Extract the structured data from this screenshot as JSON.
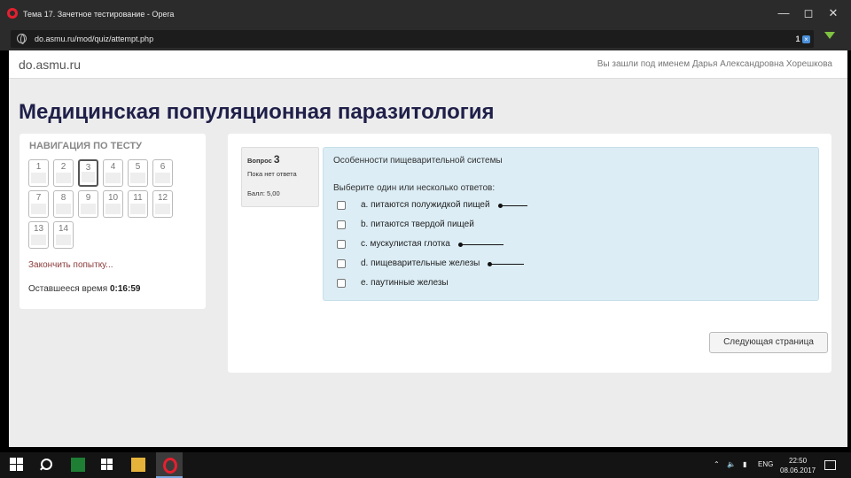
{
  "browser": {
    "window_title": "Тема 17. Зачетное тестирование - Opera",
    "url": "do.asmu.ru/mod/quiz/attempt.php",
    "address_badge": "1"
  },
  "header": {
    "site_name": "do.asmu.ru",
    "login_info": "Вы зашли под именем Дарья Александровна Хорешкова"
  },
  "course_title": "Медицинская популяционная паразитология",
  "navigation": {
    "title": "НАВИГАЦИЯ ПО ТЕСТУ",
    "questions": [
      "1",
      "2",
      "3",
      "4",
      "5",
      "6",
      "7",
      "8",
      "9",
      "10",
      "11",
      "12",
      "13",
      "14"
    ],
    "current": "3",
    "finish_label": "Закончить попытку...",
    "time_label": "Оставшееся время",
    "time_value": "0:16:59"
  },
  "question": {
    "label": "Вопрос",
    "number": "3",
    "state": "Пока нет ответа",
    "grade": "Балл: 5,00",
    "topic": "Особенности пищеварительной системы",
    "prompt": "Выберите один или несколько ответов:",
    "options": [
      {
        "text": "a. питаются полужидкой пищей",
        "marked": true
      },
      {
        "text": "b. питаются твердой пищей",
        "marked": false
      },
      {
        "text": "c. мускулистая глотка",
        "marked": true
      },
      {
        "text": "d. пищеварительные железы",
        "marked": true
      },
      {
        "text": "e. паутинные железы",
        "marked": false
      }
    ]
  },
  "next_button": "Следующая страница",
  "taskbar": {
    "language": "ENG",
    "time": "22:50",
    "date": "08.06.2017"
  }
}
